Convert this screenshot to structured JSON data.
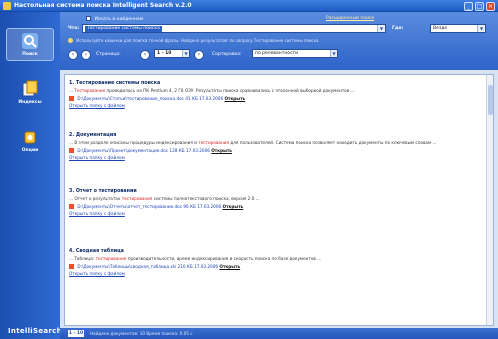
{
  "window": {
    "title": "Настольная система поиска Intelligent Search v.2.0",
    "buttons": [
      "_",
      "□",
      "×"
    ]
  },
  "sidebar": {
    "items": [
      {
        "label": "Поиск",
        "icon": "search-icon"
      },
      {
        "label": "Индексы",
        "icon": "index-icon"
      },
      {
        "label": "Опции",
        "icon": "options-icon"
      }
    ],
    "brand": "IntelliSearch"
  },
  "toolbar": {
    "checkbox_label": "Искать в найденном",
    "extended_link": "Расширенный поиск",
    "search_label": "Что:",
    "search_value": "Тестирование системы поиска",
    "where_label": "Где:",
    "where_value": "Везде",
    "hint": "Используйте кавычки для поиска точной фразы. Найдено результатов: по запросу Тестирование системы поиска",
    "nav_label": "Страница:",
    "pages_value": "1 - 10",
    "sort_label": "Сортировка:",
    "sort_value": "по релевантности"
  },
  "results": [
    {
      "title": "1. Тестирование системы поиска",
      "snippet_before": "... ",
      "snippet_hl": "Тестирование",
      "snippet_after": " проводилось на ПК Pentium 4, 2 Гб ОЗУ. Результаты поиска сравнивались с эталонной выборкой документов ...",
      "file": "D:\\Документы\\Статьи\\тестирование_поиска.doc",
      "meta": "41 КБ  17.03.2006",
      "open": "Открыть",
      "folder": "Открыть папку с файлом"
    },
    {
      "title": "2. Документация",
      "snippet_before": "... В этом разделе описаны процедуры индексирования и ",
      "snippet_hl": "тестирования",
      "snippet_after": " для пользователей. Система поиска позволяет находить документы по ключевым словам ...",
      "file": "D:\\Документы\\Проект\\документация.doc",
      "meta": "128 КБ  17.03.2006",
      "open": "Открыть",
      "folder": "Открыть папку с файлом"
    },
    {
      "title": "3. Отчет о тестировании",
      "snippet_before": "... Отчет о результатах ",
      "snippet_hl": "тестирования",
      "snippet_after": " системы полнотекстового поиска, версия 2.0 ...",
      "file": "D:\\Документы\\Отчеты\\отчет_тестирование.doc",
      "meta": "96 КБ  17.03.2006",
      "open": "Открыть",
      "folder": "Открыть папку с файлом"
    },
    {
      "title": "4. Сводная таблица",
      "snippet_before": "... Таблица: ",
      "snippet_hl": "тестирование",
      "snippet_after": " производительности, время индексирования и скорость поиска по базе документов ...",
      "file": "D:\\Документы\\Таблицы\\сводная_таблица.xls",
      "meta": "210 КБ  17.03.2006",
      "open": "Открыть",
      "folder": "Открыть папку с файлом"
    }
  ],
  "status": {
    "page": "1 - 10",
    "text": "Найдено документов: 10   Время поиска: 0.05 с"
  }
}
